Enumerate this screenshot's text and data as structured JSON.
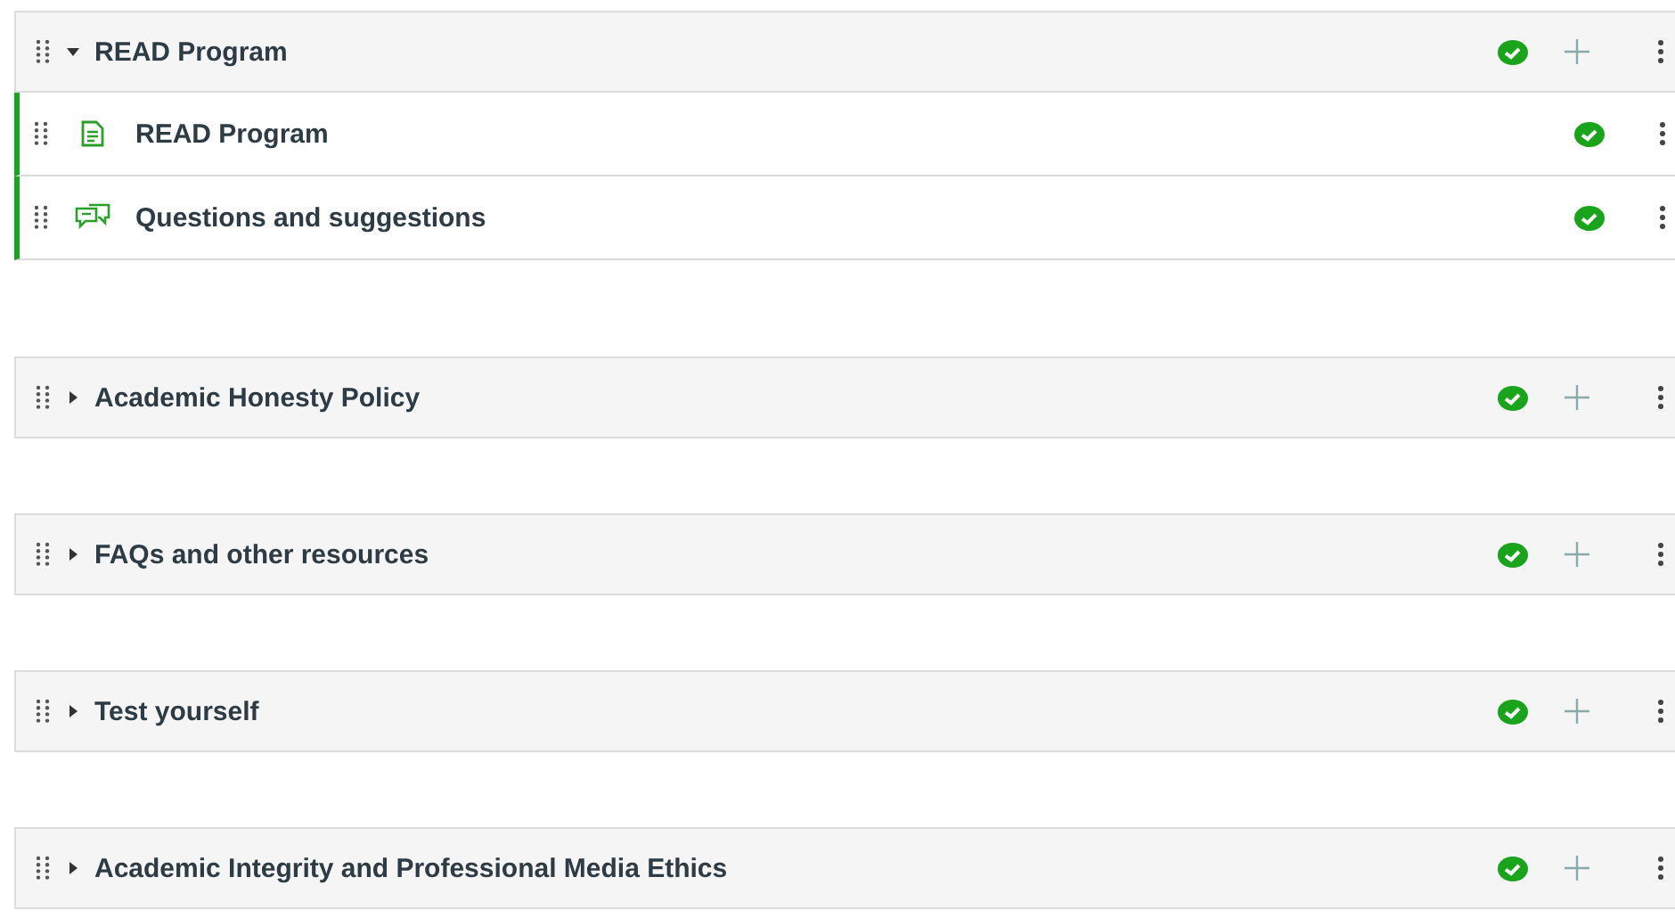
{
  "modules": [
    {
      "title": "READ Program",
      "expanded": true,
      "published": true,
      "items": [
        {
          "kind": "page",
          "title": "READ Program",
          "published": true
        },
        {
          "kind": "discussion",
          "title": "Questions and suggestions",
          "published": true
        }
      ]
    },
    {
      "title": "Academic Honesty Policy",
      "expanded": false,
      "published": true
    },
    {
      "title": "FAQs and other resources",
      "expanded": false,
      "published": true
    },
    {
      "title": "Test yourself",
      "expanded": false,
      "published": true
    },
    {
      "title": "Academic Integrity and Professional Media Ethics",
      "expanded": false,
      "published": true
    }
  ]
}
